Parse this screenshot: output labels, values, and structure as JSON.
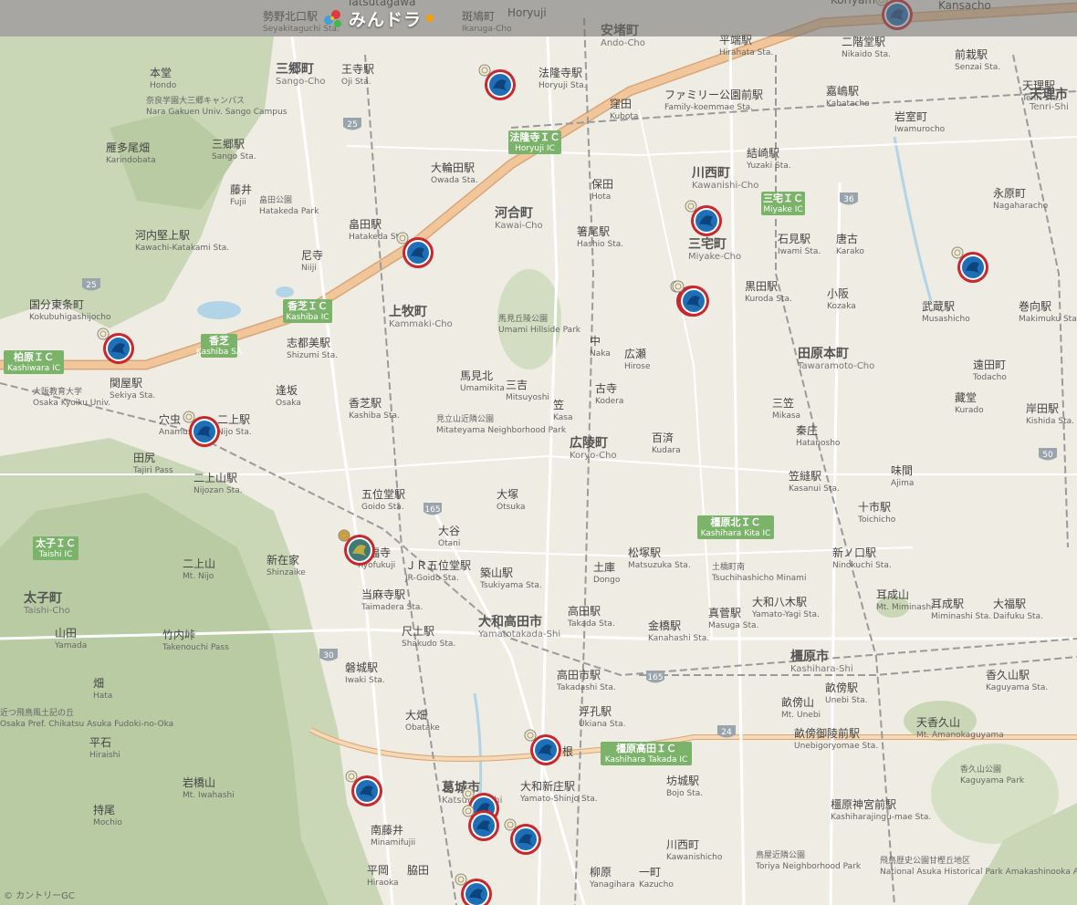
{
  "app": {
    "logo_text": "みんドラ"
  },
  "colors": {
    "land": "#efece3",
    "hills": "#c9d7b6",
    "hills_dark": "#b8cba3",
    "water": "#b3d4e6",
    "highway": "#f0c69a",
    "highway_edge": "#d9a679",
    "road": "#ffffff",
    "rail": "#9a9a9a",
    "ic_badge": "#7cb36a",
    "marker_ring": "#c8272d",
    "marker_fill": "#1e6fb5"
  },
  "top_labels": [
    {
      "jp": "勢野北口駅",
      "en": "Seyakitaguchi Sta."
    },
    {
      "jp": "斑鳩町",
      "en": "Ikaruga-Cho"
    },
    {
      "jp": "Tatsutagawa",
      "en": ""
    },
    {
      "jp": "Horyuji",
      "en": ""
    },
    {
      "jp": "Kansacho",
      "en": ""
    },
    {
      "jp": "Koriyam",
      "en": ""
    }
  ],
  "stations": [
    {
      "jp": "王寺駅",
      "en": "Oji Sta."
    },
    {
      "jp": "法隆寺駅",
      "en": "Horyuji Sta."
    },
    {
      "jp": "平端駅",
      "en": "Hirahata Sta."
    },
    {
      "jp": "二階堂駅",
      "en": "Nikaido Sta."
    },
    {
      "jp": "前栽駅",
      "en": "Senzai Sta."
    },
    {
      "jp": "天理駅",
      "en": "Tenri Sta."
    },
    {
      "jp": "ファミリー公園前駅",
      "en": "Family-koemmae Sta."
    },
    {
      "jp": "嘉嶋駅",
      "en": "Kabatacho"
    },
    {
      "jp": "三郷駅",
      "en": "Sango Sta."
    },
    {
      "jp": "大輪田駅",
      "en": "Owada Sta."
    },
    {
      "jp": "結崎駅",
      "en": "Yuzaki Sta."
    },
    {
      "jp": "畠田駅",
      "en": "Hatakeda Sta."
    },
    {
      "jp": "箸尾駅",
      "en": "Hashio Sta."
    },
    {
      "jp": "石見駅",
      "en": "Iwami Sta."
    },
    {
      "jp": "河内堅上駅",
      "en": "Kawachi-Katakami Sta."
    },
    {
      "jp": "黒田駅",
      "en": "Kuroda Sta."
    },
    {
      "jp": "志都美駅",
      "en": "Shizumi Sta."
    },
    {
      "jp": "関屋駅",
      "en": "Sekiya Sta."
    },
    {
      "jp": "香芝駅",
      "en": "Kashiba Sta."
    },
    {
      "jp": "二上駅",
      "en": "Nijo Sta."
    },
    {
      "jp": "二上山駅",
      "en": "Nijozan Sta."
    },
    {
      "jp": "五位堂駅",
      "en": "Goido Sta."
    },
    {
      "jp": "笠縫駅",
      "en": "Kasanui Sta."
    },
    {
      "jp": "十市駅",
      "en": "Toichicho"
    },
    {
      "jp": "新ノ口駅",
      "en": "Ninokuchi Sta."
    },
    {
      "jp": "ＪＲ五位堂駅",
      "en": "JR-Goido Sta."
    },
    {
      "jp": "築山駅",
      "en": "Tsukiyama Sta."
    },
    {
      "jp": "松塚駅",
      "en": "Matsuzuka Sta."
    },
    {
      "jp": "当麻寺駅",
      "en": "Taimadera Sta."
    },
    {
      "jp": "高田駅",
      "en": "Takada Sta."
    },
    {
      "jp": "大和八木駅",
      "en": "Yamato-Yagi Sta."
    },
    {
      "jp": "耳成駅",
      "en": "Miminashi Sta."
    },
    {
      "jp": "大福駅",
      "en": "Daifuku Sta."
    },
    {
      "jp": "尺土駅",
      "en": "Shakudo Sta."
    },
    {
      "jp": "金橋駅",
      "en": "Kanahashi Sta."
    },
    {
      "jp": "真菅駅",
      "en": "Masuga Sta."
    },
    {
      "jp": "磐城駅",
      "en": "Iwaki Sta."
    },
    {
      "jp": "高田市駅",
      "en": "Takadashi Sta."
    },
    {
      "jp": "畝傍駅",
      "en": "Unebi Sta."
    },
    {
      "jp": "香久山駅",
      "en": "Kaguyama Sta."
    },
    {
      "jp": "浮孔駅",
      "en": "Ukiana Sta."
    },
    {
      "jp": "畝傍御陵前駅",
      "en": "Unebigoryomae Sta."
    },
    {
      "jp": "大和新庄駅",
      "en": "Yamato-Shinjo Sta."
    },
    {
      "jp": "坊城駅",
      "en": "Bojo Sta."
    },
    {
      "jp": "橿原神宮前駅",
      "en": "Kashiharajingu-mae Sta."
    },
    {
      "jp": "岸田駅",
      "en": "Kishida Sta."
    },
    {
      "jp": "巻向駅",
      "en": "Makimuku Sta."
    },
    {
      "jp": "武蔵駅",
      "en": "Musashicho"
    }
  ],
  "towns": [
    {
      "jp": "三郷町",
      "en": "Sango-Cho"
    },
    {
      "jp": "安堵町",
      "en": "Ando-Cho"
    },
    {
      "jp": "川西町",
      "en": "Kawanishi-Cho"
    },
    {
      "jp": "河合町",
      "en": "Kawai-Cho"
    },
    {
      "jp": "三宅町",
      "en": "Miyake-Cho"
    },
    {
      "jp": "上牧町",
      "en": "Kammaki-Cho"
    },
    {
      "jp": "田原本町",
      "en": "Tawaramoto-Cho"
    },
    {
      "jp": "広陵町",
      "en": "Koryo-Cho"
    },
    {
      "jp": "大和高田市",
      "en": "Yamatotakada-Shi"
    },
    {
      "jp": "太子町",
      "en": "Taishi-Cho"
    },
    {
      "jp": "橿原市",
      "en": "Kashihara-Shi"
    },
    {
      "jp": "葛城市",
      "en": "Katsuragi-Shi"
    },
    {
      "jp": "天理市",
      "en": "Tenri-Shi"
    }
  ],
  "places": [
    {
      "jp": "本堂",
      "en": "Hondo"
    },
    {
      "jp": "雁多尾畑",
      "en": "Karindobata"
    },
    {
      "jp": "藤井",
      "en": "Fujii"
    },
    {
      "jp": "尼寺",
      "en": "Niiji"
    },
    {
      "jp": "国分東条町",
      "en": "Kokubuhigashijocho"
    },
    {
      "jp": "逢坂",
      "en": "Osaka"
    },
    {
      "jp": "馬見北",
      "en": "Umamikita"
    },
    {
      "jp": "三吉",
      "en": "Mitsuyoshi"
    },
    {
      "jp": "中",
      "en": "Naka"
    },
    {
      "jp": "広瀬",
      "en": "Hirose"
    },
    {
      "jp": "古寺",
      "en": "Kodera"
    },
    {
      "jp": "笠",
      "en": "Kasa"
    },
    {
      "jp": "百済",
      "en": "Kudara"
    },
    {
      "jp": "三笠",
      "en": "Mikasa"
    },
    {
      "jp": "秦庄",
      "en": "Hatanosho"
    },
    {
      "jp": "味間",
      "en": "Ajima"
    },
    {
      "jp": "大塚",
      "en": "Otsuka"
    },
    {
      "jp": "大谷",
      "en": "Otani"
    },
    {
      "jp": "土庫",
      "en": "Dongo"
    },
    {
      "jp": "山田",
      "en": "Yamada"
    },
    {
      "jp": "畑",
      "en": "Hata"
    },
    {
      "jp": "平石",
      "en": "Hiraishi"
    },
    {
      "jp": "持尾",
      "en": "Mochio"
    },
    {
      "jp": "南藤井",
      "en": "Minamifujii"
    },
    {
      "jp": "平岡",
      "en": "Hiraoka"
    },
    {
      "jp": "脇田",
      "en": ""
    },
    {
      "jp": "大畑",
      "en": "Obatake"
    },
    {
      "jp": "根",
      "en": ""
    },
    {
      "jp": "川西町",
      "en": "Kawanishicho"
    },
    {
      "jp": "一町",
      "en": "Kazucho"
    },
    {
      "jp": "柳原",
      "en": "Yanagihara"
    },
    {
      "jp": "保田",
      "en": "Hota"
    },
    {
      "jp": "窪田",
      "en": "Kubota"
    },
    {
      "jp": "唐古",
      "en": "Karako"
    },
    {
      "jp": "小阪",
      "en": "Kozaka"
    },
    {
      "jp": "遠田町",
      "en": "Todacho"
    },
    {
      "jp": "藏堂",
      "en": "Kurado"
    },
    {
      "jp": "岩室町",
      "en": "Iwamurocho"
    },
    {
      "jp": "永原町",
      "en": "Nagaharacho"
    },
    {
      "jp": "新在家",
      "en": "Shinzaike"
    },
    {
      "jp": "良福寺",
      "en": "Ryofukuji"
    },
    {
      "jp": "穴虫",
      "en": "Anamushi"
    },
    {
      "jp": "田尻",
      "en": "Tajiri Pass"
    },
    {
      "jp": "二上山",
      "en": "Mt. Nijo"
    },
    {
      "jp": "竹内峠",
      "en": "Takenouchi Pass"
    },
    {
      "jp": "耳成山",
      "en": "Mt. Miminashi"
    },
    {
      "jp": "天香久山",
      "en": "Mt. Amanokaguyama"
    },
    {
      "jp": "畝傍山",
      "en": "Mt. Unebi"
    },
    {
      "jp": "岩橋山",
      "en": "Mt. Iwahashi"
    }
  ],
  "parks": [
    {
      "jp": "奈良学園大三郷キャンパス",
      "en": "Nara Gakuen Univ. Sango Campus"
    },
    {
      "jp": "畠田公園",
      "en": "Hatakeda Park"
    },
    {
      "jp": "馬見丘陵公園",
      "en": "Umami Hillside Park"
    },
    {
      "jp": "見立山近隣公園",
      "en": "Mitateyama Neighborhood Park"
    },
    {
      "jp": "大阪教育大学",
      "en": "Osaka Kyoiku Univ."
    },
    {
      "jp": "鳥屋近隣公園",
      "en": "Toriya Neighborhood Park"
    },
    {
      "jp": "飛鳥歴史公園甘樫丘地区",
      "en": "National Asuka Historical Park Amakashinooka Area"
    },
    {
      "jp": "近つ飛鳥風土記の丘",
      "en": "Osaka Pref. Chikatsu Asuka Fudoki-no-Oka"
    },
    {
      "jp": "香久山公園",
      "en": "Kaguyama Park"
    },
    {
      "jp": "土橋町南",
      "en": "Tsuchihashicho Minami"
    }
  ],
  "interchanges": [
    {
      "jp": "法隆寺ＩＣ",
      "en": "Horyuji IC"
    },
    {
      "jp": "三宅ＩＣ",
      "en": "Miyake IC"
    },
    {
      "jp": "香芝ＩＣ",
      "en": "Kashiba IC"
    },
    {
      "jp": "香芝",
      "en": "Kashiba SA"
    },
    {
      "jp": "柏原ＩＣ",
      "en": "Kashiwara IC"
    },
    {
      "jp": "太子ＩＣ",
      "en": "Taishi IC"
    },
    {
      "jp": "橿原北ＩＣ",
      "en": "Kashihara Kita IC"
    },
    {
      "jp": "橿原高田ＩＣ",
      "en": "Kashihara Takada IC"
    }
  ],
  "route_shields": [
    "25",
    "25",
    "36",
    "165",
    "165",
    "24",
    "30",
    "50"
  ],
  "attribution": "© カントリーGC",
  "markers": [
    {
      "kind": "blue"
    },
    {
      "kind": "blue"
    },
    {
      "kind": "blue"
    },
    {
      "kind": "blue"
    },
    {
      "kind": "blue"
    },
    {
      "kind": "blue"
    },
    {
      "kind": "blue"
    },
    {
      "kind": "blue"
    },
    {
      "kind": "gold"
    },
    {
      "kind": "blue"
    },
    {
      "kind": "blue"
    },
    {
      "kind": "blue"
    },
    {
      "kind": "blue"
    },
    {
      "kind": "blue"
    },
    {
      "kind": "blue"
    },
    {
      "kind": "blue"
    }
  ]
}
